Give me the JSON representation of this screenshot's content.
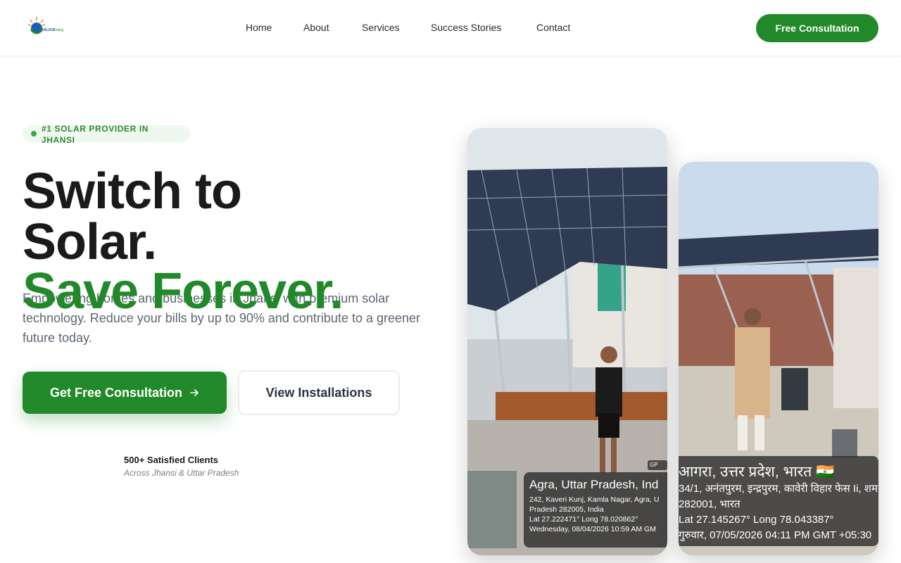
{
  "brand": {
    "logo_text": "HILIOX Energy"
  },
  "nav": {
    "items": [
      {
        "label": "Home"
      },
      {
        "label": "About"
      },
      {
        "label": "Services"
      },
      {
        "label": "Success Stories"
      },
      {
        "label": "Contact"
      }
    ],
    "cta": "Free Consultation"
  },
  "hero": {
    "badge": "#1 SOLAR PROVIDER IN JHANSI",
    "headline_line1": "Switch to",
    "headline_line2": "Solar.",
    "headline_line3": "Save Forever.",
    "description": "Empowering homes and businesses in Jhansi with premium solar technology. Reduce your bills by up to 90% and contribute to a greener future today.",
    "primary_button": "Get Free Consultation",
    "secondary_button": "View Installations",
    "clients_title": "500+ Satisfied Clients",
    "clients_subtitle": "Across Jhansi & Uttar Pradesh"
  },
  "photos": [
    {
      "location_title": "Agra, Uttar Pradesh, Ind",
      "address_line1": "242, Kaveri Kunj, Kamla Nagar, Agra, U",
      "address_line2": "Pradesh 282005, India",
      "coords": "Lat 27.222471° Long 78.020862°",
      "timestamp": "Wednesday, 08/04/2026 10:59 AM GM",
      "gps_tag": "GP"
    },
    {
      "location_title": "आगरा, उत्तर प्रदेश, भारत 🇮🇳",
      "address_line1": "34/1, अनंतपुरम, इन्द्रपुरम, कावेरी विहार फेस Ii, शम",
      "address_line2": "282001, भारत",
      "coords": "Lat 27.145267° Long 78.043387°",
      "timestamp": "गुरुवार, 07/05/2026 04:11 PM GMT +05:30"
    }
  ],
  "colors": {
    "brand_green": "#22892a",
    "headline_dark": "#1a1a1a",
    "badge_bg": "#eef8ee",
    "body_text": "#5c6670"
  }
}
